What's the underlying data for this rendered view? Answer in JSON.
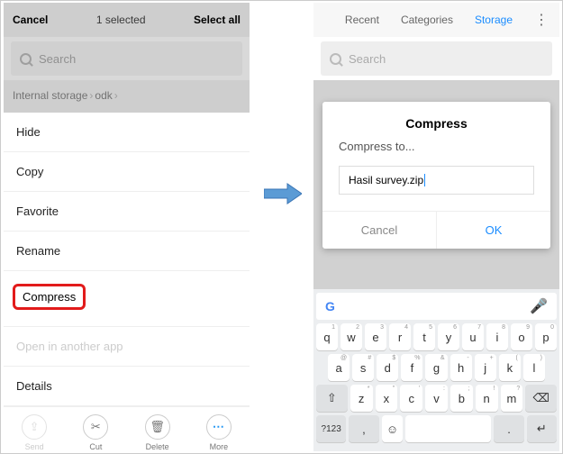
{
  "left": {
    "topbar": {
      "cancel": "Cancel",
      "count": "1 selected",
      "select_all": "Select all"
    },
    "search_placeholder": "Search",
    "breadcrumb": {
      "root": "Internal storage",
      "folder": "odk"
    },
    "menu": {
      "hide": "Hide",
      "copy": "Copy",
      "favorite": "Favorite",
      "rename": "Rename",
      "compress": "Compress",
      "open_in": "Open in another app",
      "details": "Details"
    },
    "actions": {
      "send": "Send",
      "cut": "Cut",
      "delete": "Delete",
      "more": "More"
    }
  },
  "right": {
    "tabs": {
      "recent": "Recent",
      "categories": "Categories",
      "storage": "Storage"
    },
    "search_placeholder": "Search",
    "dialog": {
      "title": "Compress",
      "subtitle": "Compress to...",
      "filename": "Hasil survey.zip",
      "cancel": "Cancel",
      "ok": "OK"
    },
    "keyboard": {
      "row1": [
        "q",
        "w",
        "e",
        "r",
        "t",
        "y",
        "u",
        "i",
        "o",
        "p"
      ],
      "row1_sup": [
        "1",
        "2",
        "3",
        "4",
        "5",
        "6",
        "7",
        "8",
        "9",
        "0"
      ],
      "row2": [
        "a",
        "s",
        "d",
        "f",
        "g",
        "h",
        "j",
        "k",
        "l"
      ],
      "row2_sup": [
        "@",
        "#",
        "$",
        "%",
        "&",
        "-",
        "+",
        "(",
        ")"
      ],
      "row3": [
        "z",
        "x",
        "c",
        "v",
        "b",
        "n",
        "m"
      ],
      "row3_sup": [
        "*",
        "\"",
        "'",
        ":",
        ";",
        "!",
        "?"
      ],
      "sym": "?123",
      "comma": ",",
      "period": "."
    }
  }
}
